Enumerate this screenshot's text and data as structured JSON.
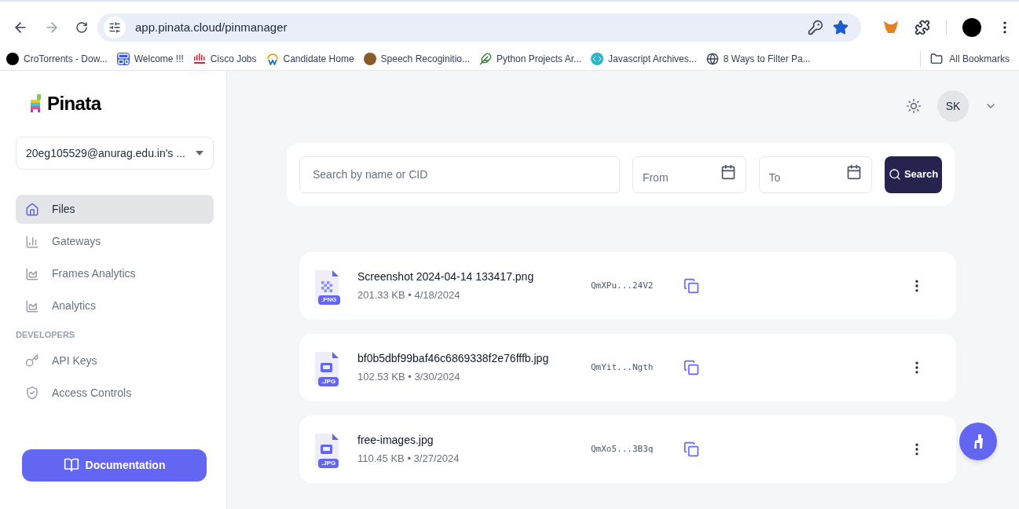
{
  "browser": {
    "url": "app.pinata.cloud/pinmanager",
    "bookmarks": [
      {
        "label": "CroTorrents - Dow...",
        "kind": "torrent"
      },
      {
        "label": "Welcome !!!",
        "kind": "window"
      },
      {
        "label": "Cisco Jobs",
        "kind": "cisco"
      },
      {
        "label": "Candidate Home",
        "kind": "w"
      },
      {
        "label": "Speech Recoginitio...",
        "kind": "ball"
      },
      {
        "label": "Python Projects Ar...",
        "kind": "feather"
      },
      {
        "label": "Javascript Archives...",
        "kind": "code"
      },
      {
        "label": "8 Ways to Filter Pa...",
        "kind": "globe"
      }
    ],
    "all_bookmarks": "All Bookmarks"
  },
  "sidebar": {
    "logo": "Pinata",
    "account": "20eg105529@anurag.edu.in's ...",
    "items": [
      {
        "label": "Files",
        "selected": true
      },
      {
        "label": "Gateways",
        "selected": false
      },
      {
        "label": "Frames Analytics",
        "selected": false
      },
      {
        "label": "Analytics",
        "selected": false
      }
    ],
    "section": "DEVELOPERS",
    "dev_items": [
      {
        "label": "API Keys",
        "selected": false
      },
      {
        "label": "Access Controls",
        "selected": false
      }
    ],
    "documentation": "Documentation"
  },
  "header": {
    "avatar": "SK"
  },
  "search": {
    "placeholder": "Search by name or CID",
    "from": "From",
    "to": "To",
    "button": "Search"
  },
  "files": [
    {
      "name": "Screenshot 2024-04-14 133417.png",
      "size": "201.33 KB",
      "date": "4/18/2024",
      "ext": ".PNG",
      "kind": "png",
      "cid": "QmXPu...24V2"
    },
    {
      "name": "bf0b5dbf99baf46c6869338f2e76fffb.jpg",
      "size": "102.53 KB",
      "date": "3/30/2024",
      "ext": ".JPG",
      "kind": "jpg",
      "cid": "QmYit...Ngth"
    },
    {
      "name": "free-images.jpg",
      "size": "110.45 KB",
      "date": "3/27/2024",
      "ext": ".JPG",
      "kind": "jpg",
      "cid": "QmXo5...3B3q"
    }
  ],
  "separator": "•"
}
